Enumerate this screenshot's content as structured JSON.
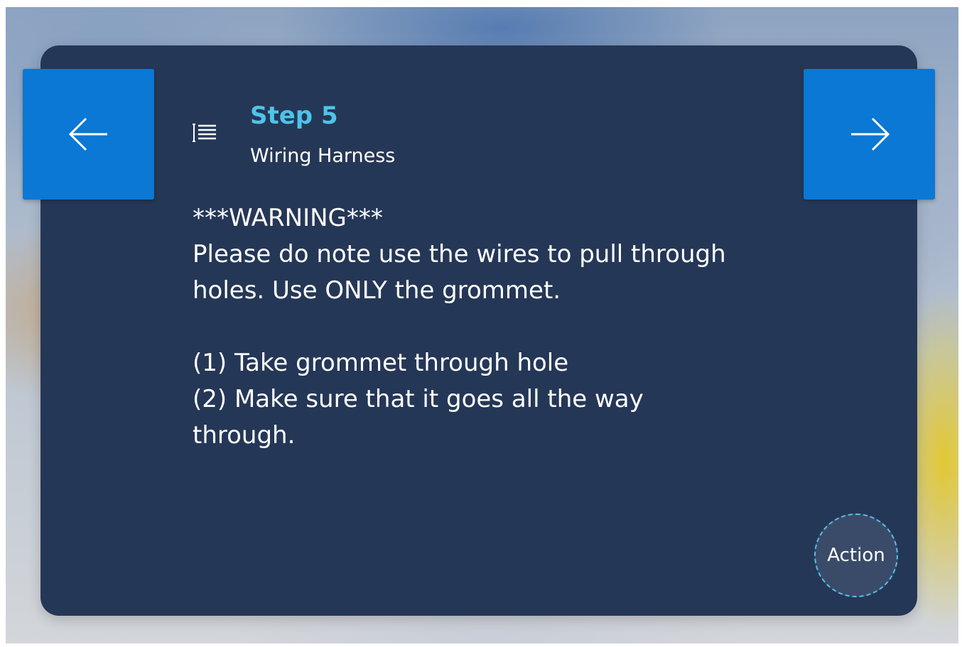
{
  "header": {
    "step_label": "Step 5",
    "step_name": "Wiring Harness"
  },
  "navigation": {
    "prev_icon": "arrow-left-icon",
    "next_icon": "arrow-right-icon"
  },
  "instructions": {
    "lines": [
      "***WARNING***",
      "Please do note use the wires to pull through",
      "holes. Use ONLY the grommet.",
      "",
      "(1) Take grommet through hole",
      "(2) Make sure that it goes all the way",
      "through."
    ]
  },
  "action": {
    "label": "Action"
  },
  "colors": {
    "card": "#253756",
    "accent_button": "#0a78d4",
    "step_title": "#4fc3e8",
    "action_border": "#55bfe6"
  }
}
